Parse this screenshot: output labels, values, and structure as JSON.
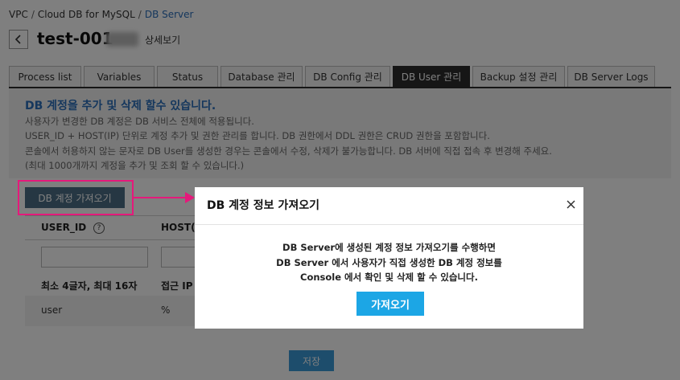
{
  "breadcrumb": {
    "items": [
      "VPC",
      "Cloud DB for MySQL"
    ],
    "current": "DB Server"
  },
  "header": {
    "title": "test-001-",
    "subtitle": "상세보기"
  },
  "tabs": [
    {
      "label": "Process list"
    },
    {
      "label": "Variables"
    },
    {
      "label": "Status"
    },
    {
      "label": "Database 관리"
    },
    {
      "label": "DB Config 관리"
    },
    {
      "label": "DB User 관리"
    },
    {
      "label": "Backup 설정 관리"
    },
    {
      "label": "DB Server Logs"
    }
  ],
  "active_tab": "DB User 관리",
  "info": {
    "heading": "DB 계정을 추가 및 삭제 할수 있습니다.",
    "lines": [
      "사용자가 변경한 DB 계정은 DB 서비스 전체에 적용됩니다.",
      "USER_ID + HOST(IP) 단위로 계정 추가 및 권한 관리를 합니다.   DB 권한에서 DDL 권한은 CRUD 권한을 포함합니다.",
      "콘솔에서 허용하지 않는 문자로 DB User를 생성한 경우는 콘솔에서 수정, 삭제가 불가능합니다.   DB 서버에 직접 접속 후 변경해 주세요.",
      "(최대 1000개까지 계정을 추가 및 조회 할 수 있습니다.)"
    ]
  },
  "fetch_button_label": "DB 계정 가져오기",
  "table": {
    "headers": [
      "USER_ID",
      "HOST(IP"
    ],
    "hints": [
      "최소 4글자, 최대 16자",
      "접근 IP"
    ],
    "rows": [
      [
        "user",
        "%"
      ]
    ]
  },
  "save_button_label": "저장",
  "modal": {
    "title": "DB 계정 정보 가져오기",
    "body": [
      "DB Server에 생성된 계정 정보 가져오기를 수행하면",
      "DB Server 에서 사용자가 직접 생성한 DB 계정 정보를",
      "Console 에서 확인 및 삭제 할 수 있습니다."
    ],
    "confirm_label": "가져오기"
  },
  "colors": {
    "accent": "#2a6ebb",
    "highlight": "#e5197b",
    "primary_button": "#1ca6e5"
  },
  "icons": {
    "back": "chevron-left-icon",
    "help": "question-circle-icon",
    "close": "close-icon",
    "annotation": "arrow-right-icon"
  }
}
